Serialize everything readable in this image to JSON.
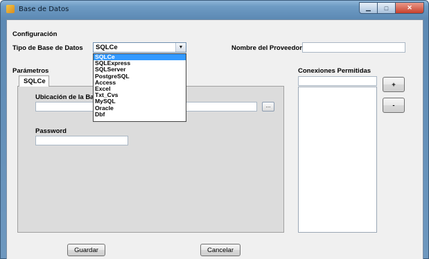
{
  "window": {
    "title": "Base de Datos"
  },
  "configuracion": {
    "heading": "Configuración",
    "tipo_label": "Tipo de Base de Datos",
    "tipo_value": "SQLCe",
    "proveedor_label": "Nombre del Proveedor",
    "proveedor_value": ""
  },
  "dropdown": {
    "options": [
      "SQLCe",
      "SQLExpress",
      "SQLServer",
      "PostgreSQL",
      "Access",
      "Excel",
      "Txt_Cvs",
      "MySQL",
      "Oracle",
      "Dbf"
    ],
    "selected_index": 0
  },
  "parametros": {
    "heading": "Parámetros",
    "tab_label": "SQLCe",
    "ubicacion_label": "Ubicación de la Bas",
    "ubicacion_value": "",
    "browse_label": "...",
    "password_label": "Password",
    "password_value": ""
  },
  "conexiones": {
    "heading": "Conexiones Permitidas",
    "input_value": "",
    "add_label": "+",
    "remove_label": "-"
  },
  "buttons": {
    "save": "Guardar",
    "cancel": "Cancelar"
  },
  "colors": {
    "selection": "#3399ff",
    "panel": "#dcdcdc",
    "client": "#f0f0f0"
  }
}
